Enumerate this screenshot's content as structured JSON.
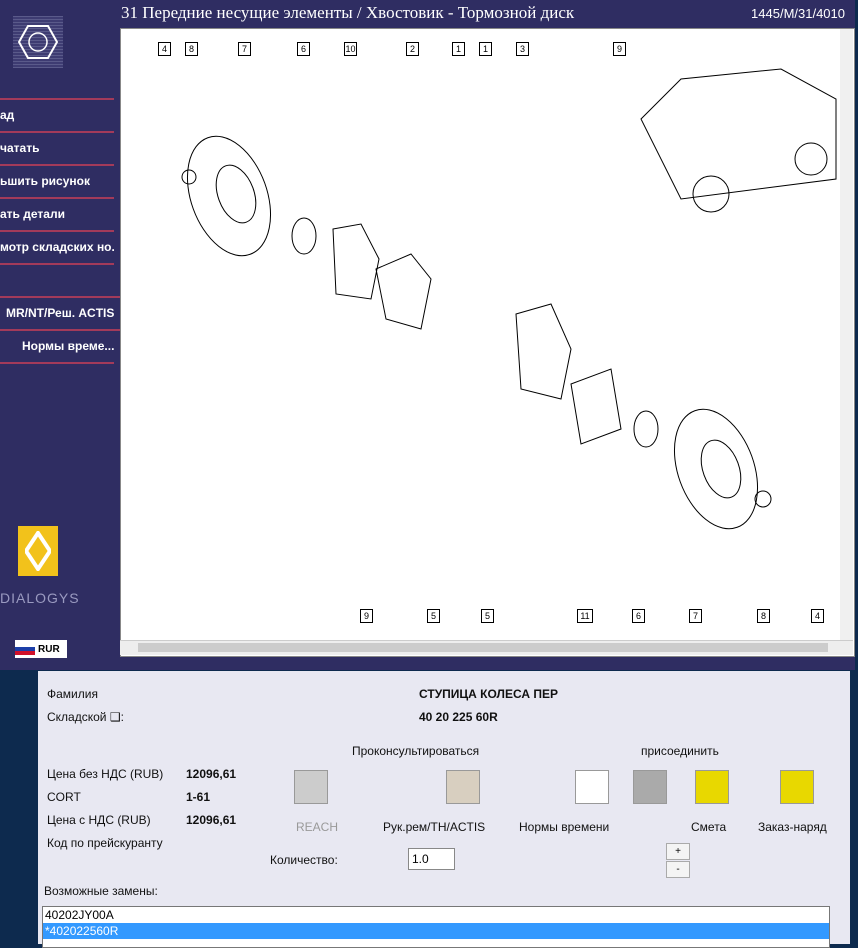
{
  "header": {
    "title": "31 Передние несущие элементы / Хвостовик - Тормозной диск",
    "code": "1445/M/31/4010"
  },
  "sidebar": {
    "items": [
      {
        "label": "ад"
      },
      {
        "label": "чатать"
      },
      {
        "label": "ьшить рисунок"
      },
      {
        "label": "ать детали"
      },
      {
        "label": "мотр складских но..."
      },
      {
        "label": ""
      },
      {
        "label": "MR/NT/Реш. ACTIS"
      },
      {
        "label": "Нормы време..."
      }
    ],
    "brand": "DIALOGYS",
    "currency": "RUR"
  },
  "diagram": {
    "top_callouts": [
      "4",
      "8",
      "7",
      "6",
      "10",
      "2",
      "1",
      "1",
      "3",
      "9"
    ],
    "bottom_callouts": [
      "9",
      "5",
      "5",
      "11",
      "6",
      "7",
      "8",
      "4"
    ]
  },
  "details": {
    "family_label": "Фамилия",
    "family_value": "СТУПИЦА КОЛЕСА ПЕР",
    "stock_label": "Складской ❑:",
    "stock_value": "40 20 225 60R",
    "consult_label": "Проконсультироваться",
    "attach_label": "присоединить",
    "price_net_label": "Цена без НДС (RUB)",
    "price_net": "12096,61",
    "cort_label": "CORT",
    "cort": "1-61",
    "price_gross_label": "Цена с НДС (RUB)",
    "price_gross": "12096,61",
    "tariff_label": "Код по прейскуранту",
    "buttons": {
      "reach": "REACH",
      "manual": "Рук.рем/TH/ACTIS",
      "norms": "Нормы времени",
      "estimate": "Смета",
      "order": "Заказ-наряд"
    },
    "qty_label": "Количество:",
    "qty": "1.0",
    "plus": "+",
    "minus": "-",
    "replacements_label": "Возможные замены:",
    "replacements": [
      "40202JY00A",
      "*402022560R"
    ]
  }
}
